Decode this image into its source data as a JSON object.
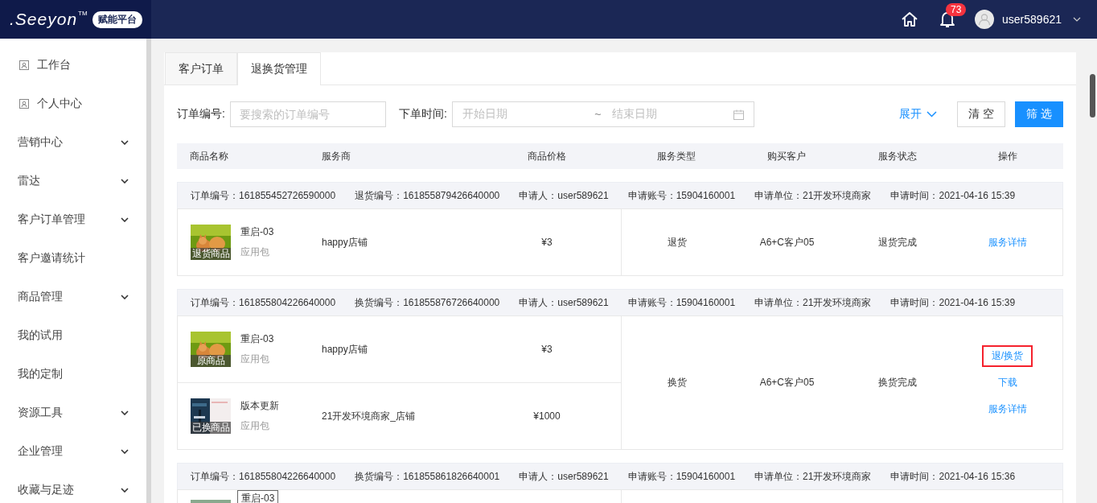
{
  "header": {
    "logo": ".Seeyon",
    "trademark": "TM",
    "badge": "赋能平台",
    "notification_count": "73",
    "username": "user589621"
  },
  "sidebar": {
    "items": [
      {
        "label": "工作台",
        "kind": "page"
      },
      {
        "label": "个人中心",
        "kind": "page"
      },
      {
        "label": "营销中心",
        "kind": "group",
        "expanded": false
      },
      {
        "label": "雷达",
        "kind": "group",
        "expanded": false
      },
      {
        "label": "客户订单管理",
        "kind": "group",
        "expanded": false
      },
      {
        "label": "客户邀请统计",
        "kind": "link"
      },
      {
        "label": "商品管理",
        "kind": "group",
        "expanded": false
      },
      {
        "label": "我的试用",
        "kind": "link"
      },
      {
        "label": "我的定制",
        "kind": "link"
      },
      {
        "label": "资源工具",
        "kind": "group",
        "expanded": false
      },
      {
        "label": "企业管理",
        "kind": "group",
        "expanded": false
      },
      {
        "label": "收藏与足迹",
        "kind": "group",
        "expanded": false
      }
    ]
  },
  "tabs": [
    {
      "label": "客户订单",
      "selected": false
    },
    {
      "label": "退换货管理",
      "selected": true
    }
  ],
  "filters": {
    "order_no": {
      "label": "订单编号:",
      "placeholder": "要搜索的订单编号"
    },
    "date": {
      "label": "下单时间:",
      "start_placeholder": "开始日期",
      "separator": "~",
      "end_placeholder": "结束日期"
    },
    "expand": "展开",
    "clear": "清 空",
    "submit": "筛 选"
  },
  "table": {
    "columns": [
      "商品名称",
      "服务商",
      "商品价格",
      "服务类型",
      "购买客户",
      "服务状态",
      "操作"
    ],
    "orders": [
      {
        "fields": [
          "订单编号：161855452726590000",
          "退货编号：161855879426640000",
          "申请人：user589621",
          "申请账号：15904160001",
          "申请单位：21开发环境商家",
          "申请时间：2021-04-16 15:39"
        ],
        "products": [
          {
            "name": "重启-03",
            "type": "应用包",
            "caption": "退货商品",
            "provider": "happy店铺",
            "price": "¥3"
          }
        ],
        "service_type": "退货",
        "customer": "A6+C客户05",
        "status": "退货完成",
        "actions": [
          {
            "label": "服务详情",
            "highlighted": false
          }
        ]
      },
      {
        "fields": [
          "订单编号：161855804226640000",
          "换货编号：161855876726640000",
          "申请人：user589621",
          "申请账号：15904160001",
          "申请单位：21开发环境商家",
          "申请时间：2021-04-16 15:39"
        ],
        "products": [
          {
            "name": "重启-03",
            "type": "应用包",
            "caption": "原商品",
            "provider": "happy店铺",
            "price": "¥3"
          },
          {
            "name": "版本更新",
            "type": "应用包",
            "caption": "已换商品",
            "provider": "21开发环境商家_店铺",
            "price": "¥1000"
          }
        ],
        "service_type": "换货",
        "customer": "A6+C客户05",
        "status": "换货完成",
        "actions": [
          {
            "label": "退/换货",
            "highlighted": true
          },
          {
            "label": "下载",
            "highlighted": false
          },
          {
            "label": "服务详情",
            "highlighted": false
          }
        ]
      },
      {
        "fields": [
          "订单编号：161855804226640000",
          "换货编号：161855861826640001",
          "申请人：user589621",
          "申请账号：15904160001",
          "申请单位：21开发环境商家",
          "申请时间：2021-04-16 15:36"
        ],
        "tooltip": "重启-03"
      }
    ]
  }
}
